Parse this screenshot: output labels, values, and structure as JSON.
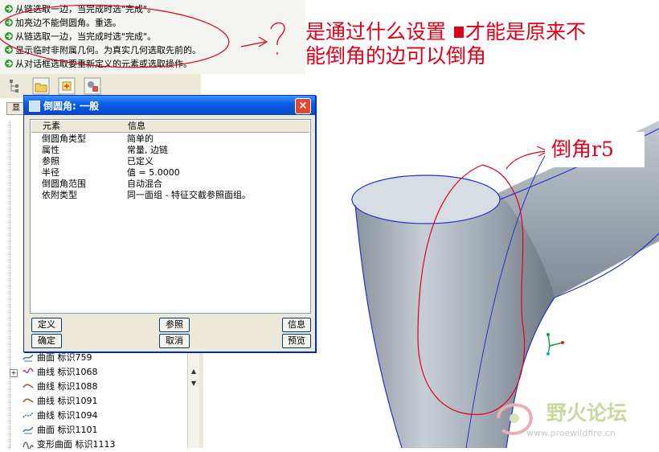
{
  "messages": [
    "从链选取一边，当完成时选\"完成\"。",
    "加亮边不能倒圆角。重选。",
    "从链选取一边，当完成时选\"完成\"。",
    "显示临时非附属几何。为真实几何选取先前的。",
    "从对话框选取要重新定义的元素或选取操作。"
  ],
  "dialog": {
    "title": "倒圆角: 一般",
    "close": "×",
    "header": {
      "col1": "元素",
      "col2": "信息"
    },
    "rows": [
      {
        "name": "倒圆角类型",
        "value": "简单的"
      },
      {
        "name": "属性",
        "value": "常量, 边链"
      },
      {
        "name": "参照",
        "value": "已定义"
      },
      {
        "name": "半径",
        "value": "值 = 5.0000"
      },
      {
        "name": "倒圆角范围",
        "value": "自动混合"
      },
      {
        "name": "依附类型",
        "value": "同一面组 - 特征交截参照面组。"
      }
    ],
    "buttons": {
      "define": "定义",
      "refs": "参照",
      "info": "信息",
      "ok": "确定",
      "cancel": "取消",
      "preview": "预览"
    }
  },
  "tree": {
    "items": [
      {
        "icon": "surface-icon",
        "label": "曲面 标识759"
      },
      {
        "icon": "curve-icon",
        "label": "曲线 标识1068"
      },
      {
        "icon": "curve-icon",
        "label": "曲线 标识1088"
      },
      {
        "icon": "curve-icon",
        "label": "曲线 标识1091"
      },
      {
        "icon": "curve-icon",
        "label": "曲线 标识1094"
      },
      {
        "icon": "surface-icon",
        "label": "曲面 标识1101"
      },
      {
        "icon": "warp-surface-icon",
        "label": "变形曲面 标识1113"
      }
    ],
    "tab_label": "显"
  },
  "annotations": {
    "question": "是通过什么设置",
    "question_rest": "才能是原来不",
    "question_line2": "能倒角的边可以倒角",
    "fillet_note": "倒角r5"
  },
  "watermark": {
    "name": "野火论坛",
    "url": "www.proewildfire.cn"
  },
  "colors": {
    "annotation_red": "#e0001a",
    "title_blue": "#0a5fe8",
    "model_gray": "#9aa3ad"
  }
}
